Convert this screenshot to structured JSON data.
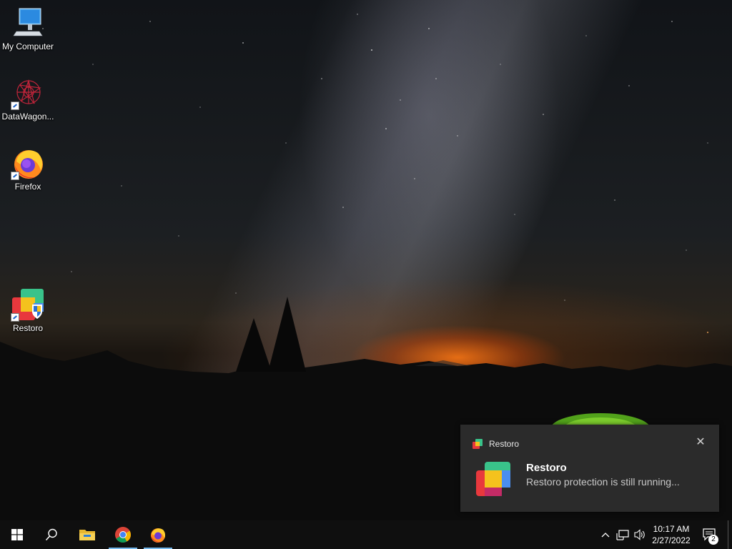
{
  "desktop_icons": [
    {
      "label": "My Computer",
      "icon": "my-computer-icon"
    },
    {
      "label": "DataWagon...",
      "icon": "datawagon-icon"
    },
    {
      "label": "Firefox",
      "icon": "firefox-icon"
    },
    {
      "label": "Restoro",
      "icon": "restoro-icon"
    }
  ],
  "notification": {
    "app_name": "Restoro",
    "title": "Restoro",
    "message": "Restoro protection is still running...",
    "close_glyph": "✕"
  },
  "taskbar": {
    "pinned": [
      "start-icon",
      "search-icon",
      "file-explorer-icon",
      "chrome-icon",
      "firefox-icon"
    ],
    "tray": {
      "chevron_glyph": "^",
      "time": "10:17 AM",
      "date": "2/27/2022",
      "notification_count": "2"
    }
  },
  "colors": {
    "taskbar": "#0f0f0f",
    "toast_bg": "#2b2b2b",
    "active_indicator": "#76b9ed"
  }
}
